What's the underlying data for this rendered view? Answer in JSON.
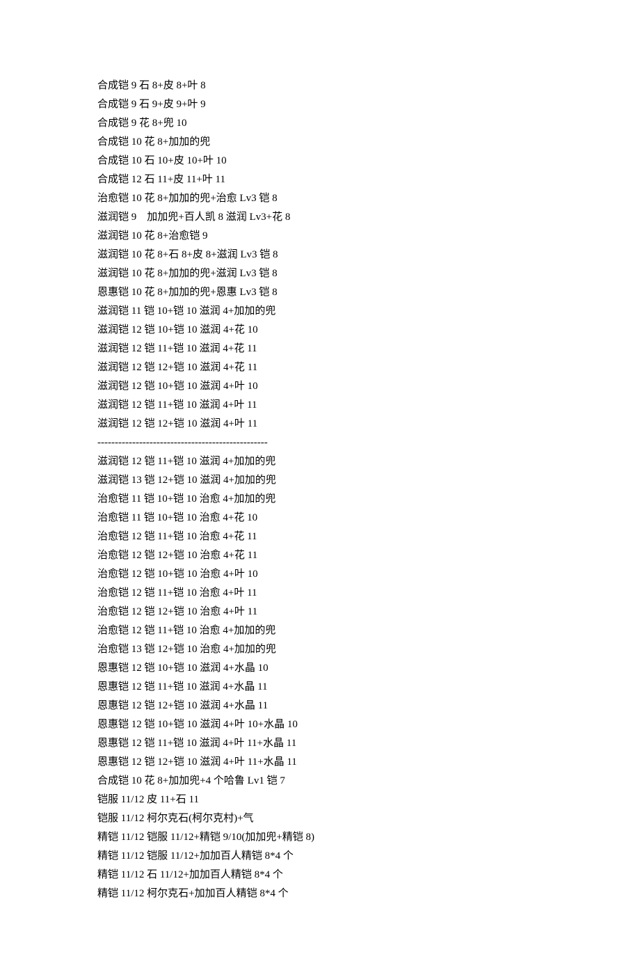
{
  "lines": [
    "合成铠 9 石 8+皮 8+叶 8",
    "合成铠 9 石 9+皮 9+叶 9",
    "合成铠 9 花 8+兜 10",
    "合成铠 10 花 8+加加的兜",
    "合成铠 10 石 10+皮 10+叶 10",
    "合成铠 12 石 11+皮 11+叶 11",
    "治愈铠 10 花 8+加加的兜+治愈 Lv3 铠 8",
    "滋润铠 9    加加兜+百人凯 8 滋润 Lv3+花 8",
    "滋润铠 10 花 8+治愈铠 9",
    "滋润铠 10 花 8+石 8+皮 8+滋润 Lv3 铠 8",
    "滋润铠 10 花 8+加加的兜+滋润 Lv3 铠 8",
    "恩惠铠 10 花 8+加加的兜+恩惠 Lv3 铠 8",
    "滋润铠 11 铠 10+铠 10 滋润 4+加加的兜",
    "滋润铠 12 铠 10+铠 10 滋润 4+花 10",
    "滋润铠 12 铠 11+铠 10 滋润 4+花 11",
    "滋润铠 12 铠 12+铠 10 滋润 4+花 11",
    "滋润铠 12 铠 10+铠 10 滋润 4+叶 10",
    "滋润铠 12 铠 11+铠 10 滋润 4+叶 11",
    "滋润铠 12 铠 12+铠 10 滋润 4+叶 11",
    "-------------------------------------------------",
    "滋润铠 12 铠 11+铠 10 滋润 4+加加的兜",
    "滋润铠 13 铠 12+铠 10 滋润 4+加加的兜",
    "治愈铠 11 铠 10+铠 10 治愈 4+加加的兜",
    "治愈铠 11 铠 10+铠 10 治愈 4+花 10",
    "治愈铠 12 铠 11+铠 10 治愈 4+花 11",
    "治愈铠 12 铠 12+铠 10 治愈 4+花 11",
    "治愈铠 12 铠 10+铠 10 治愈 4+叶 10",
    "治愈铠 12 铠 11+铠 10 治愈 4+叶 11",
    "治愈铠 12 铠 12+铠 10 治愈 4+叶 11",
    "治愈铠 12 铠 11+铠 10 治愈 4+加加的兜",
    "治愈铠 13 铠 12+铠 10 治愈 4+加加的兜",
    "恩惠铠 12 铠 10+铠 10 滋润 4+水晶 10",
    "恩惠铠 12 铠 11+铠 10 滋润 4+水晶 11",
    "恩惠铠 12 铠 12+铠 10 滋润 4+水晶 11",
    "恩惠铠 12 铠 10+铠 10 滋润 4+叶 10+水晶 10",
    "恩惠铠 12 铠 11+铠 10 滋润 4+叶 11+水晶 11",
    "恩惠铠 12 铠 12+铠 10 滋润 4+叶 11+水晶 11",
    "合成铠 10 花 8+加加兜+4 个哈鲁 Lv1 铠 7",
    "铠服 11/12 皮 11+石 11",
    "铠服 11/12 柯尔克石(柯尔克村)+气",
    "精铠 11/12 铠服 11/12+精铠 9/10(加加兜+精铠 8)",
    "精铠 11/12 铠服 11/12+加加百人精铠 8*4 个",
    "精铠 11/12 石 11/12+加加百人精铠 8*4 个",
    "精铠 11/12 柯尔克石+加加百人精铠 8*4 个"
  ]
}
